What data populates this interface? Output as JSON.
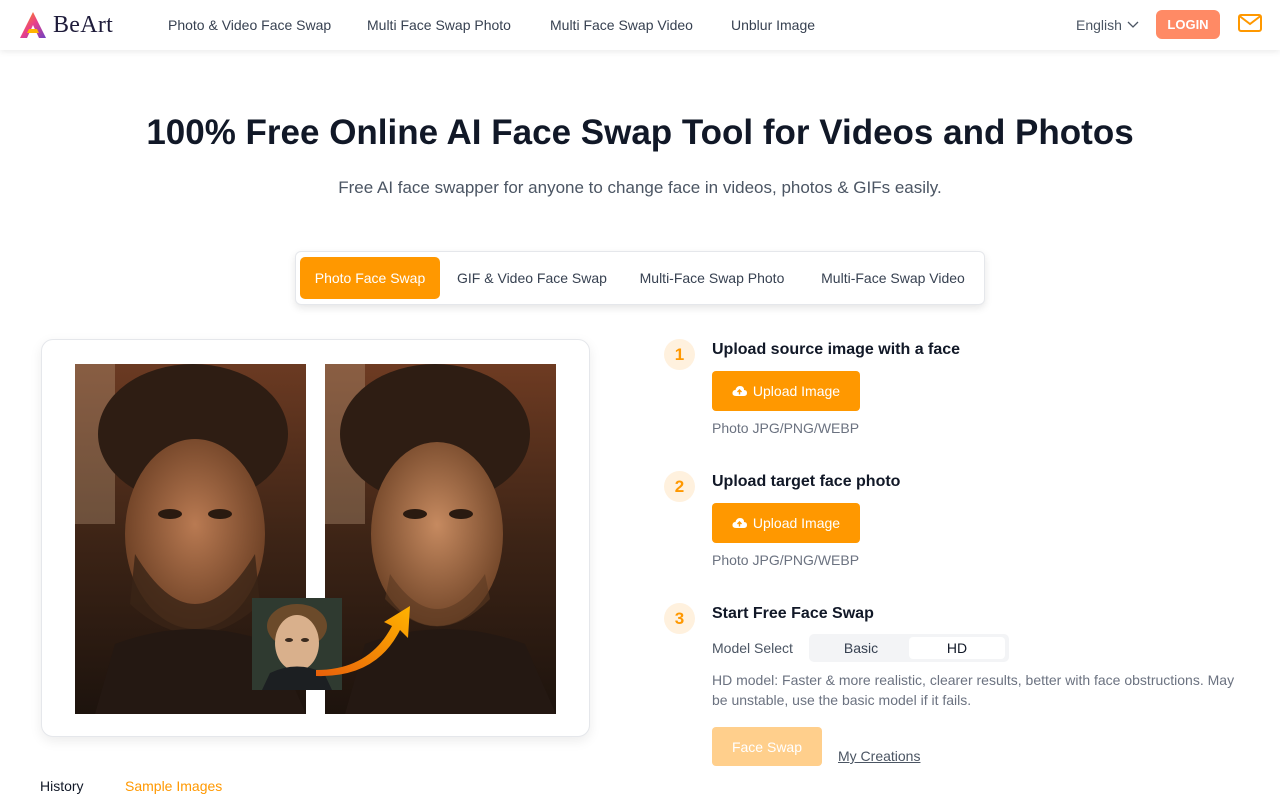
{
  "header": {
    "brand": "BeArt",
    "nav": [
      "Photo & Video Face Swap",
      "Multi Face Swap Photo",
      "Multi Face Swap Video",
      "Unblur Image"
    ],
    "language": "English",
    "login_label": "LOGIN"
  },
  "hero": {
    "title": "100% Free Online AI Face Swap Tool for Videos and Photos",
    "subtitle": "Free AI face swapper for anyone to change face in videos, photos & GIFs easily."
  },
  "tabs": [
    {
      "label": "Photo Face Swap",
      "active": true
    },
    {
      "label": "GIF & Video Face Swap",
      "active": false
    },
    {
      "label": "Multi-Face Swap Photo",
      "active": false
    },
    {
      "label": "Multi-Face Swap Video",
      "active": false
    }
  ],
  "steps": [
    {
      "number": "1",
      "title": "Upload source image with a face",
      "button": "Upload Image",
      "hint": "Photo JPG/PNG/WEBP"
    },
    {
      "number": "2",
      "title": "Upload target face photo",
      "button": "Upload Image",
      "hint": "Photo JPG/PNG/WEBP"
    },
    {
      "number": "3",
      "title": "Start Free Face Swap"
    }
  ],
  "model": {
    "label": "Model Select",
    "options": [
      "Basic",
      "HD"
    ],
    "selected": "HD",
    "description": "HD model: Faster & more realistic, clearer results, better with face obstructions. May be unstable, use the basic model if it fails."
  },
  "actions": {
    "face_swap": "Face Swap",
    "my_creations": "My Creations"
  },
  "bottom_tabs": {
    "history": "History",
    "samples": "Sample Images"
  },
  "colors": {
    "accent": "#ff9800",
    "login": "#ff8a65",
    "disabled_button": "#ffcf8c"
  }
}
